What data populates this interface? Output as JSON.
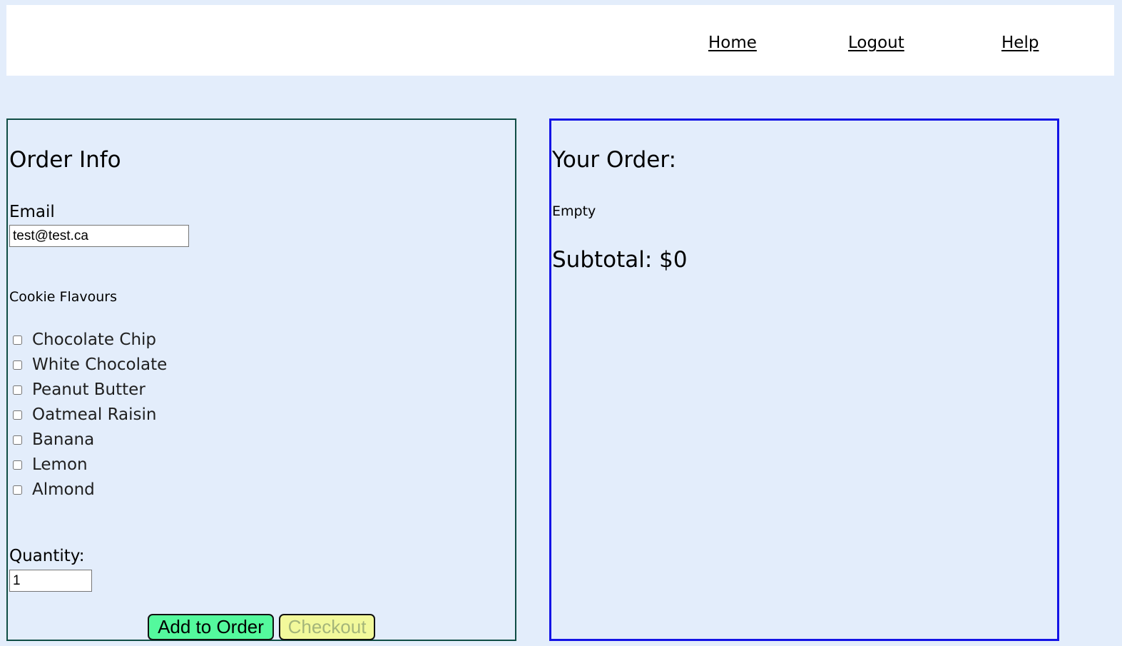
{
  "nav": {
    "home": "Home",
    "logout": "Logout",
    "help": "Help"
  },
  "order_info": {
    "title": "Order Info",
    "email_label": "Email",
    "email_value": "test@test.ca",
    "flavours_label": "Cookie Flavours",
    "flavours": [
      {
        "label": "Chocolate Chip",
        "checked": false
      },
      {
        "label": "White Chocolate",
        "checked": false
      },
      {
        "label": "Peanut Butter",
        "checked": false
      },
      {
        "label": "Oatmeal Raisin",
        "checked": false
      },
      {
        "label": "Banana",
        "checked": false
      },
      {
        "label": "Lemon",
        "checked": false
      },
      {
        "label": "Almond",
        "checked": false
      }
    ],
    "quantity_label": "Quantity:",
    "quantity_value": "1",
    "add_button": "Add to Order",
    "checkout_button": "Checkout"
  },
  "your_order": {
    "title": "Your Order:",
    "status": "Empty",
    "subtotal": "Subtotal: $0"
  },
  "colors": {
    "page_background": "#e3edfb",
    "header_background": "#ffffff",
    "left_panel_border": "#0f4d45",
    "right_panel_border": "#1414e6",
    "add_button": "#54f99d",
    "checkout_button": "#f2f99b",
    "checkout_text": "#a4b57a"
  }
}
